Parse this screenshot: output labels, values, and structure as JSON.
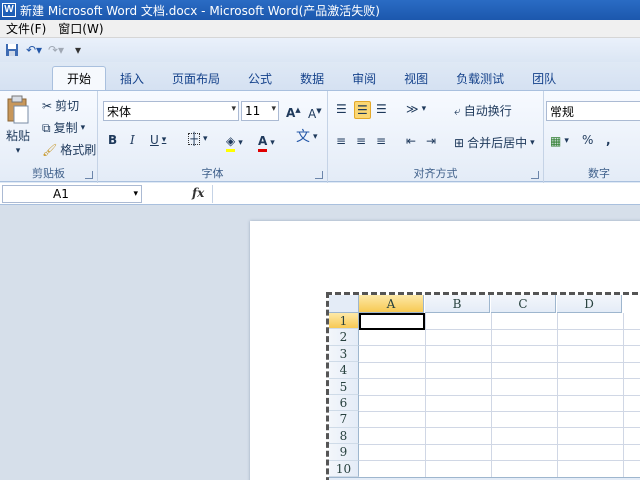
{
  "window": {
    "title": "新建 Microsoft Word 文档.docx - Microsoft Word(产品激活失败)"
  },
  "menubar": {
    "items": [
      "文件(F)",
      "窗口(W)"
    ]
  },
  "tabs": [
    "开始",
    "插入",
    "页面布局",
    "公式",
    "数据",
    "审阅",
    "视图",
    "负载测试",
    "团队"
  ],
  "active_tab": "开始",
  "ribbon": {
    "clipboard": {
      "label": "剪贴板",
      "paste": "粘贴",
      "cut": "剪切",
      "copy": "复制",
      "format_painter": "格式刷"
    },
    "font": {
      "label": "字体",
      "font_name": "宋体",
      "font_size": "11",
      "bold": "B",
      "italic": "I",
      "underline": "U"
    },
    "alignment": {
      "label": "对齐方式",
      "wrap_text": "自动换行",
      "merge_center": "合并后居中"
    },
    "number": {
      "label": "数字",
      "format": "常规",
      "percent": "%",
      "comma": ","
    }
  },
  "formula_bar": {
    "name_box": "A1",
    "fx": "fx"
  },
  "sheet": {
    "columns": [
      "A",
      "B",
      "C",
      "D"
    ],
    "rows": [
      "1",
      "2",
      "3",
      "4",
      "5",
      "6",
      "7",
      "8",
      "9",
      "10"
    ],
    "selected_cell": "A1"
  },
  "colors": {
    "title_bar": "#1e5fb7",
    "accent": "#fbd774"
  }
}
